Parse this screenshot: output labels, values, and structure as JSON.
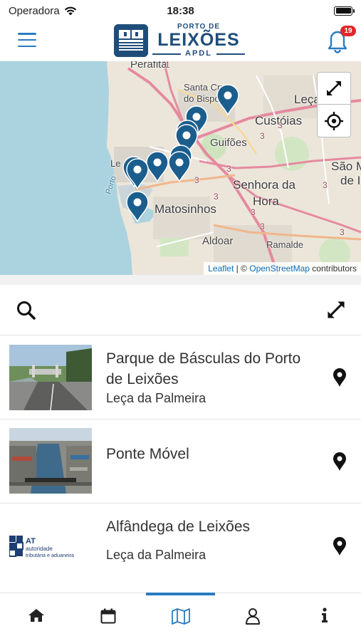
{
  "status_bar": {
    "carrier": "Operadora",
    "time": "18:38"
  },
  "header": {
    "logo": {
      "line1": "PORTO DE",
      "line2": "LEIXÕES",
      "line3": "APDL"
    },
    "notification_count": "19"
  },
  "map": {
    "labels": [
      "Perafita",
      "Santa Cruz do Bispo",
      "Leça",
      "Custóias",
      "Guifões",
      "São M",
      "de I",
      "Senhora da",
      "Hora",
      "Matosinhos",
      "Aldoar",
      "Ramalde",
      "Le",
      "Porto"
    ],
    "route_numbers": [
      "1",
      "3",
      "3",
      "3",
      "3",
      "3",
      "3",
      "3",
      "3",
      "3"
    ],
    "attribution": {
      "leaflet": "Leaflet",
      "separator": " | © ",
      "osm": "OpenStreetMap",
      "suffix": " contributors"
    },
    "pin_count": 10,
    "colors": {
      "sea": "#abd3df",
      "land": "#ece6da",
      "pin": "#1b5e8e",
      "highway": "#e58aa0"
    }
  },
  "list": {
    "items": [
      {
        "title": "Parque de Básculas do Porto de Leixões",
        "subtitle": "Leça da Palmeira",
        "thumbnail": "road-photo"
      },
      {
        "title": "Ponte Móvel",
        "subtitle": "",
        "thumbnail": "port-aerial-photo"
      },
      {
        "title": "Alfândega de Leixões",
        "subtitle": "Leça da Palmeira",
        "thumbnail": "at-logo",
        "thumb_logo": {
          "code": "AT",
          "line1": "autoridade",
          "line2": "tributária e aduaneira"
        }
      }
    ]
  },
  "tabbar": {
    "tabs": [
      {
        "icon": "home-icon"
      },
      {
        "icon": "calendar-icon"
      },
      {
        "icon": "map-icon",
        "active": true
      },
      {
        "icon": "user-icon"
      },
      {
        "icon": "info-icon"
      }
    ]
  },
  "accent_color": "#2a7bc0"
}
